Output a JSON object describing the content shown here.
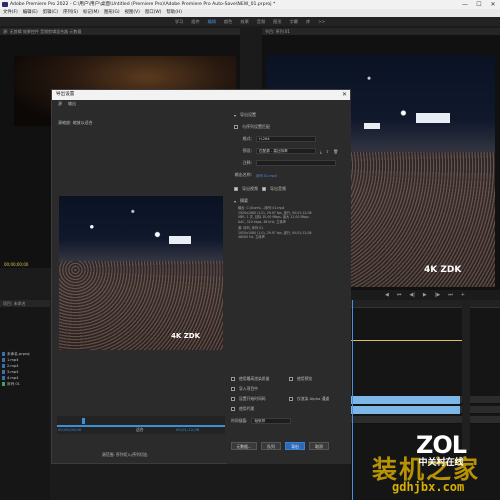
{
  "window": {
    "title": "Adobe Premiere Pro 2022 - C:\\用户\\用户\\桌面\\Untitled (Premiere Pro)\\Adobe Premiere Pro Auto-Save\\NEW_01.prproj *",
    "controls": [
      "—",
      "☐",
      "✕"
    ]
  },
  "menu": [
    "文件(F)",
    "编辑(E)",
    "剪辑(C)",
    "序列(S)",
    "标记(M)",
    "图形(G)",
    "视图(V)",
    "窗口(W)",
    "帮助(H)"
  ],
  "workspace": {
    "tabs": [
      "学习",
      "组件",
      "编辑",
      "颜色",
      "效果",
      "音频",
      "图形",
      "字幕",
      "库",
      ">>"
    ],
    "active_index": 2
  },
  "source_monitor": {
    "header": "源: 无剪辑    效果控件    音频剪辑混合器    元数据",
    "timecode": "00;00;00;00"
  },
  "program_monitor": {
    "header": "节目: 序列 01",
    "timecode": "00;01;12;08"
  },
  "project_panel": {
    "header": "项目: 未命名",
    "items": [
      "未命名.prproj",
      "1.mp4",
      "2.mp4",
      "3.mp4",
      "4.mp4",
      "序列 01"
    ]
  },
  "transport": [
    "◀",
    "⏮",
    "◀|",
    "▶",
    "|▶",
    "⏭",
    "+"
  ],
  "watermark": {
    "badge": "4K",
    "text": "ZDK"
  },
  "export_dialog": {
    "title": "导出设置",
    "close": "✕",
    "tabs": [
      "源",
      "输出"
    ],
    "source_zoom": "源缩放: 缩放以适合",
    "time_left": "00;00;00;00",
    "fit_label": "适合",
    "time_right": "00;01;12;08",
    "source_range_label": "源范围:",
    "source_range_value": "序列切入/序列切出",
    "settings": {
      "section_title": "导出设置",
      "match_sequence": "与序列设置匹配",
      "format_label": "格式:",
      "format_value": "H.264",
      "preset_label": "预设:",
      "preset_value": "匹配源 - 高比特率",
      "comments_label": "注释:",
      "output_name_label": "输出名称:",
      "output_name_value": "序列 01.mp4",
      "export_video": "导出视频",
      "export_audio": "导出音频",
      "summary_title": "摘要",
      "summary_output": "输出: C:\\Users\\...\\序列 01.mp4\n1920x1080 (1.0), 29.97 fps, 逐行, 00;01;12;08\nVBR, 1 次, 目标 10.00 Mbps, 最大 12.00 Mbps\nAAC, 320 kbps, 48 kHz, 立体声",
      "summary_source": "源: 序列, 序列 01\n1920x1080 (1.0), 29.97 fps, 逐行, 00;01;12;08\n48000 Hz, 立体声"
    },
    "subtabs": [
      "效果",
      "视频",
      "音频",
      "多路复用器",
      "字幕",
      "发布"
    ],
    "subtab_selected": 1,
    "basic_video": {
      "title": "基本视频设置",
      "match_source": "匹配源",
      "width_label": "宽度:",
      "width_value": "1,920",
      "height_label": "高度:",
      "height_value": "1,080",
      "frame_rate_label": "帧速率:"
    },
    "options": [
      {
        "label": "使用最高渲染质量",
        "checked": false
      },
      {
        "label": "使用预览",
        "checked": false
      },
      {
        "label": "导入项目中",
        "checked": false
      },
      {
        "label": "设置开始时间码",
        "checked": false
      },
      {
        "label": "仅渲染 Alpha 通道",
        "checked": false
      },
      {
        "label": "使用代理",
        "checked": false
      }
    ],
    "interpolation_label": "时间插值:",
    "interpolation_value": "帧采样",
    "buttons": {
      "metadata": "元数据...",
      "queue": "队列",
      "export": "导出",
      "cancel": "取消"
    }
  },
  "brand": {
    "logo": "ZOL",
    "logo_cn": "中关村在线",
    "site_cn": "装机之家",
    "url": "gdhjbx.com"
  }
}
